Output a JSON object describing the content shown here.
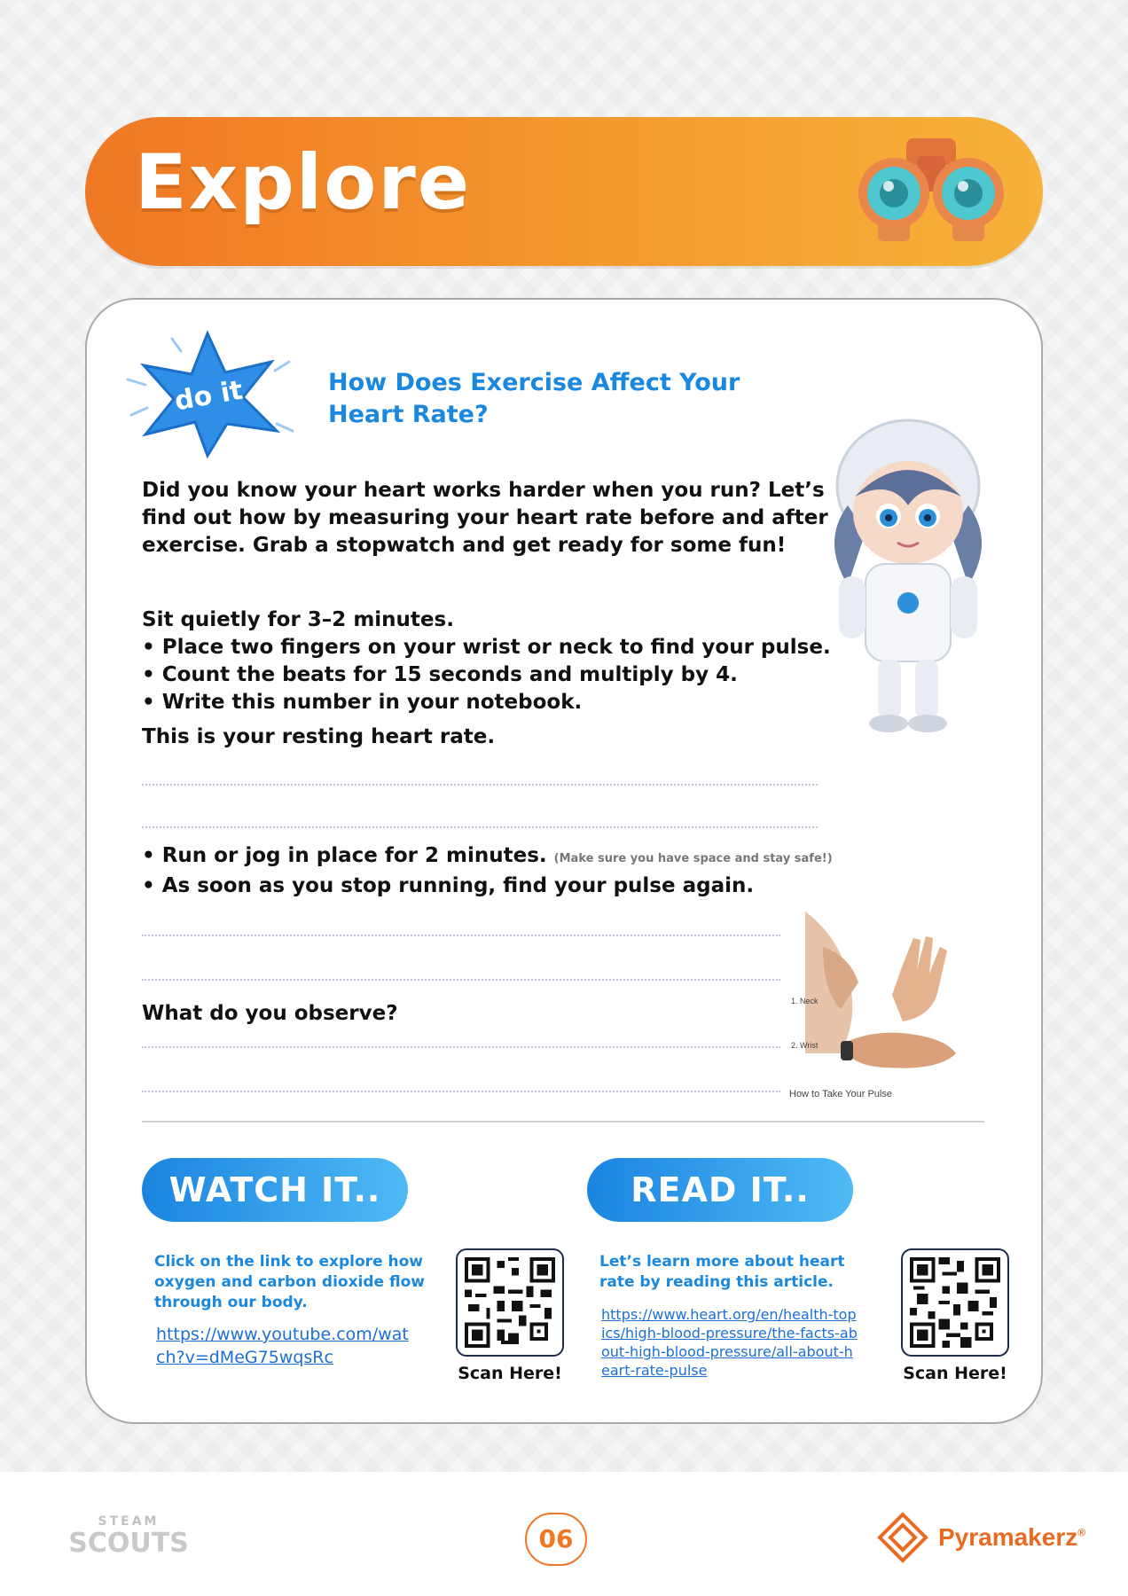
{
  "banner": {
    "title": "Explore"
  },
  "badge": {
    "label": "do it"
  },
  "activity": {
    "question": "How Does Exercise Affect Your Heart Rate?",
    "intro": "Did you know your heart works harder when you run? Let’s find out how by measuring your heart rate before and after exercise. Grab a stopwatch and get ready for some fun!",
    "steps_title": "Sit quietly for 3–2 minutes.",
    "steps": [
      "• Place two fingers on your wrist or neck to find your pulse.",
      "• Count the beats for 15 seconds and multiply by 4.",
      "• Write this number in your notebook."
    ],
    "resting": "This is your resting heart rate.",
    "run_steps": [
      "• Run or jog in place for 2 minutes.",
      "• As soon as you stop running, find your pulse again."
    ],
    "run_note": "(Make sure you have space and stay safe!)",
    "observe": "What do you observe?"
  },
  "pulse_figure": {
    "neck_label": "1. Neck",
    "wrist_label": "2. Wrist",
    "caption": "How to Take Your Pulse"
  },
  "watch": {
    "heading": "WATCH IT..",
    "description": "Click on the link to explore how oxygen and carbon dioxide flow through our body.",
    "url": "https://www.youtube.com/watch?v=dMeG75wqsRc",
    "scan": "Scan Here!"
  },
  "read": {
    "heading": "READ IT..",
    "description": "Let’s learn more about heart rate by reading this article.",
    "url": "https://www.heart.org/en/health-topics/high-blood-pressure/the-facts-about-high-blood-pressure/all-about-heart-rate-pulse",
    "scan": "Scan Here!"
  },
  "footer": {
    "left_logo_top": "STEAM",
    "left_logo_bottom": "SCOUTS",
    "page_number": "06",
    "brand": "Pyramakerz",
    "brand_mark": "®"
  },
  "colors": {
    "orange": "#f07825",
    "blue": "#1b88e0",
    "link": "#1b6fd6"
  }
}
